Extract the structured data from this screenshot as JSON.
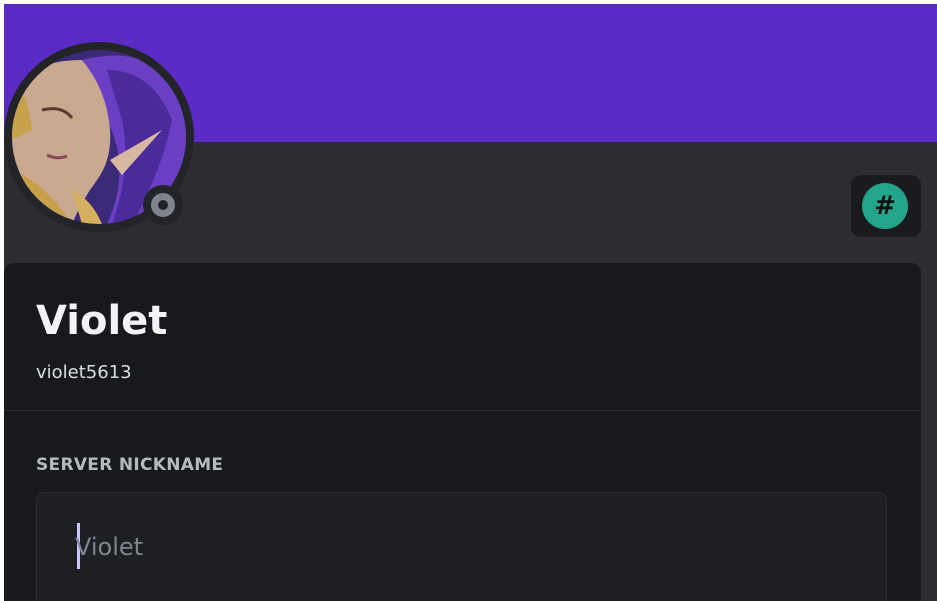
{
  "profile": {
    "display_name": "Violet",
    "username": "violet5613",
    "status": "offline",
    "badge_icon": "hashtag-icon",
    "badge_glyph": "#"
  },
  "nickname_section": {
    "label": "SERVER NICKNAME",
    "input_value": "",
    "input_placeholder": "Violet"
  },
  "colors": {
    "banner": "#5c2bc6",
    "badge": "#23a58a",
    "status_offline": "#80848e"
  }
}
